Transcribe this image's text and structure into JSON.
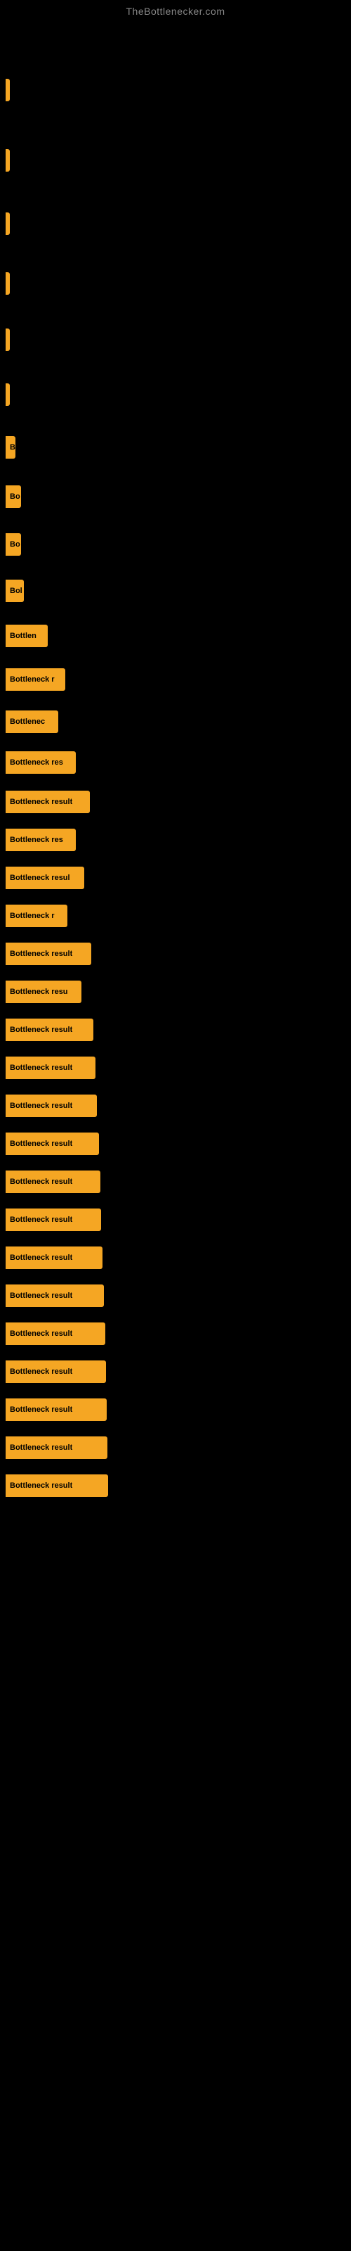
{
  "site": {
    "title": "TheBottlenecker.com"
  },
  "bars": [
    {
      "id": 1,
      "label": "",
      "width": 4,
      "gap_before": 80
    },
    {
      "id": 2,
      "label": "",
      "width": 4,
      "gap_before": 60
    },
    {
      "id": 3,
      "label": "",
      "width": 6,
      "gap_before": 50
    },
    {
      "id": 4,
      "label": "",
      "width": 4,
      "gap_before": 45
    },
    {
      "id": 5,
      "label": "",
      "width": 4,
      "gap_before": 40
    },
    {
      "id": 6,
      "label": "",
      "width": 6,
      "gap_before": 38
    },
    {
      "id": 7,
      "label": "B",
      "width": 14,
      "gap_before": 35
    },
    {
      "id": 8,
      "label": "Bo",
      "width": 22,
      "gap_before": 30
    },
    {
      "id": 9,
      "label": "Bo",
      "width": 22,
      "gap_before": 28
    },
    {
      "id": 10,
      "label": "Bol",
      "width": 26,
      "gap_before": 26
    },
    {
      "id": 11,
      "label": "Bottlen",
      "width": 60,
      "gap_before": 24
    },
    {
      "id": 12,
      "label": "Bottleneck r",
      "width": 85,
      "gap_before": 22
    },
    {
      "id": 13,
      "label": "Bottlenec",
      "width": 75,
      "gap_before": 20
    },
    {
      "id": 14,
      "label": "Bottleneck res",
      "width": 100,
      "gap_before": 18
    },
    {
      "id": 15,
      "label": "Bottleneck result",
      "width": 120,
      "gap_before": 16
    },
    {
      "id": 16,
      "label": "Bottleneck res",
      "width": 100,
      "gap_before": 14
    },
    {
      "id": 17,
      "label": "Bottleneck resul",
      "width": 112,
      "gap_before": 14
    },
    {
      "id": 18,
      "label": "Bottleneck r",
      "width": 88,
      "gap_before": 14
    },
    {
      "id": 19,
      "label": "Bottleneck result",
      "width": 122,
      "gap_before": 14
    },
    {
      "id": 20,
      "label": "Bottleneck resu",
      "width": 108,
      "gap_before": 14
    },
    {
      "id": 21,
      "label": "Bottleneck result",
      "width": 125,
      "gap_before": 14
    },
    {
      "id": 22,
      "label": "Bottleneck result",
      "width": 128,
      "gap_before": 14
    },
    {
      "id": 23,
      "label": "Bottleneck result",
      "width": 130,
      "gap_before": 14
    },
    {
      "id": 24,
      "label": "Bottleneck result",
      "width": 133,
      "gap_before": 14
    },
    {
      "id": 25,
      "label": "Bottleneck result",
      "width": 135,
      "gap_before": 14
    },
    {
      "id": 26,
      "label": "Bottleneck result",
      "width": 136,
      "gap_before": 14
    },
    {
      "id": 27,
      "label": "Bottleneck result",
      "width": 138,
      "gap_before": 14
    },
    {
      "id": 28,
      "label": "Bottleneck result",
      "width": 140,
      "gap_before": 14
    },
    {
      "id": 29,
      "label": "Bottleneck result",
      "width": 142,
      "gap_before": 14
    },
    {
      "id": 30,
      "label": "Bottleneck result",
      "width": 143,
      "gap_before": 14
    },
    {
      "id": 31,
      "label": "Bottleneck result",
      "width": 144,
      "gap_before": 14
    },
    {
      "id": 32,
      "label": "Bottleneck result",
      "width": 145,
      "gap_before": 14
    },
    {
      "id": 33,
      "label": "Bottleneck result",
      "width": 146,
      "gap_before": 14
    }
  ]
}
